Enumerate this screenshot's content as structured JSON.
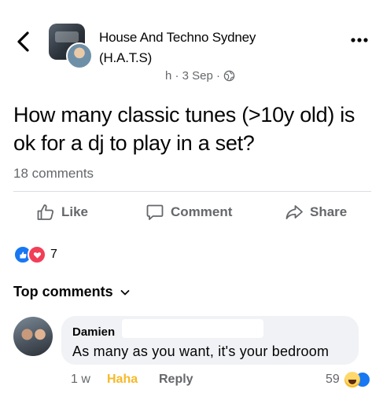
{
  "header": {
    "group_name": "House And Techno Sydney (H.A.T.S)",
    "meta": "h · 3 Sep ·",
    "icons": {
      "back": "chevron-left-icon",
      "more": "more-horizontal-icon",
      "privacy": "globe-icon"
    }
  },
  "post": {
    "text": "How many classic tunes (>10y old) is ok for a dj to play in a set?",
    "comment_count": "18 comments"
  },
  "actions": {
    "like": "Like",
    "comment": "Comment",
    "share": "Share"
  },
  "reactions": {
    "count": "7",
    "types": [
      "like",
      "love"
    ]
  },
  "comments_section": {
    "heading": "Top comments",
    "comments": [
      {
        "name": "Damien",
        "text": "As many as you want, it's your bedroom",
        "time": "1 w",
        "reaction_label": "Haha",
        "reply_label": "Reply",
        "reaction_count": "59"
      }
    ]
  },
  "colors": {
    "text": "#050505",
    "secondary": "#65676b",
    "brand_blue": "#1877f2",
    "love_red": "#f33e58",
    "haha_yellow": "#f7b928",
    "bubble_bg": "#f0f2f5",
    "divider": "#dadde1"
  }
}
